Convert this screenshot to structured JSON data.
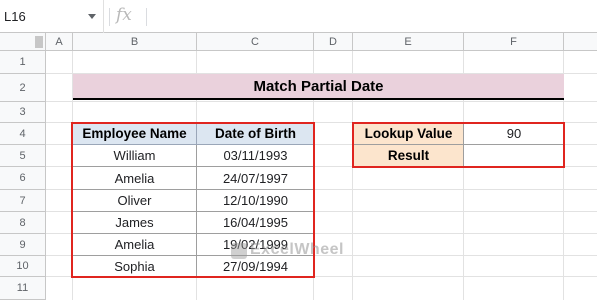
{
  "formula_bar": {
    "name_box": "L16",
    "fx": "fx"
  },
  "columns": [
    "A",
    "B",
    "C",
    "D",
    "E",
    "F"
  ],
  "rows": [
    "1",
    "2",
    "3",
    "4",
    "5",
    "6",
    "7",
    "8",
    "9",
    "10",
    "11"
  ],
  "title": "Match Partial Date",
  "table": {
    "headers": [
      "Employee Name",
      "Date of Birth"
    ],
    "rows": [
      [
        "William",
        "03/11/1993"
      ],
      [
        "Amelia",
        "24/07/1997"
      ],
      [
        "Oliver",
        "12/10/1990"
      ],
      [
        "James",
        "16/04/1995"
      ],
      [
        "Amelia",
        "19/02/1999"
      ],
      [
        "Sophia",
        "27/09/1994"
      ]
    ]
  },
  "lookup": {
    "lookup_label": "Lookup Value",
    "lookup_value": "90",
    "result_label": "Result",
    "result_value": ""
  },
  "watermark": "ExcelWheel"
}
